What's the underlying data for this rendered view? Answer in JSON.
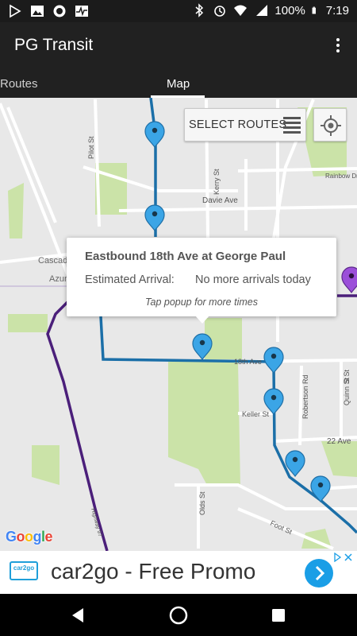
{
  "status_bar": {
    "battery": "100%",
    "time": "7:19",
    "icons": [
      "play-store-icon",
      "image-icon",
      "record-icon",
      "pulse-icon",
      "bluetooth-icon",
      "alarm-icon",
      "wifi-icon",
      "signal-icon",
      "battery-icon"
    ]
  },
  "app_bar": {
    "title": "PG Transit",
    "menu_icon": "overflow-menu-icon"
  },
  "tabs": [
    {
      "label": "Routes",
      "selected": false
    },
    {
      "label": "Map",
      "selected": true
    }
  ],
  "map": {
    "select_routes_label": "SELECT ROUTES",
    "streets": [
      "Pilot St",
      "Kerry St",
      "Davie Ave",
      "Rainbow Dr",
      "Cascad",
      "Azur",
      "18th Ave",
      "Keller St",
      "Robertson Rd",
      "Quinn St",
      "S St",
      "22 Ave",
      "Olds St",
      "Foot St",
      "Highway 97"
    ],
    "popup": {
      "title": "Eastbound 18th Ave at George Paul",
      "arrival_label": "Estimated Arrival:",
      "arrival_value": "No more arrivals today",
      "hint": "Tap popup for more times"
    },
    "attribution": "Google",
    "colors": {
      "route_blue": "#1b6fa8",
      "pin_blue": "#3ba5e6",
      "pin_purple": "#9b4fd9",
      "route_purple": "#4b1f7a",
      "park_green": "#cbe3a8",
      "map_bg": "#e8e8e8"
    }
  },
  "ad": {
    "logo": "car2go",
    "text": "car2go - Free Promo"
  },
  "nav_bar": {
    "buttons": [
      "back-icon",
      "home-icon",
      "recents-icon"
    ]
  }
}
